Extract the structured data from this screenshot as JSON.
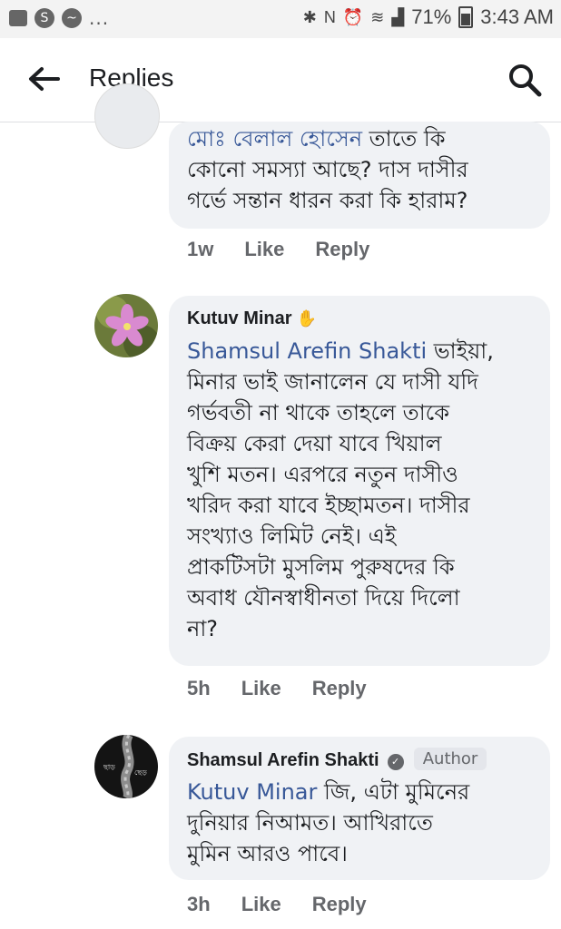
{
  "status_bar": {
    "more": "...",
    "battery": "71%",
    "time": "3:43 AM"
  },
  "header": {
    "title": "Replies"
  },
  "comments": [
    {
      "mention": "মোঃ বেলাল হোসেন",
      "text_lines": [
        "তাতে কি",
        "কোনো সমস্যা আছে? দাস দাসীর",
        "গর্ভে সন্তান ধারন করা কি হারাম?"
      ],
      "time": "1w",
      "like": "Like",
      "reply": "Reply"
    },
    {
      "name": "Kutuv Minar",
      "mention": "Shamsul Arefin Shakti",
      "text_lines": [
        "ভাইয়া,",
        "মিনার ভাই জানালেন যে দাসী যদি",
        "গর্ভবতী না থাকে তাহলে তাকে",
        "বিক্রয় কেরা দেয়া যাবে খিয়াল",
        "খুশি মতন। এরপরে নতুন দাসীও",
        "খরিদ করা যাবে ইচ্ছামতন। দাসীর",
        "সংখ্যাও লিমিট নেই। এই",
        "প্রাকটিসটা মুসলিম পুরুষদের কি",
        "অবাধ যৌনস্বাধীনতা দিয়ে দিলো",
        "না?"
      ],
      "time": "5h",
      "like": "Like",
      "reply": "Reply"
    },
    {
      "name": "Shamsul Arefin Shakti",
      "badge": "Author",
      "mention": "Kutuv Minar",
      "text_lines": [
        "জি, এটা মুমিনের",
        "দুনিয়ার নিআমত। আখিরাতে",
        "মুমিন আরও পাবে।"
      ],
      "time": "3h",
      "like": "Like",
      "reply": "Reply"
    }
  ]
}
